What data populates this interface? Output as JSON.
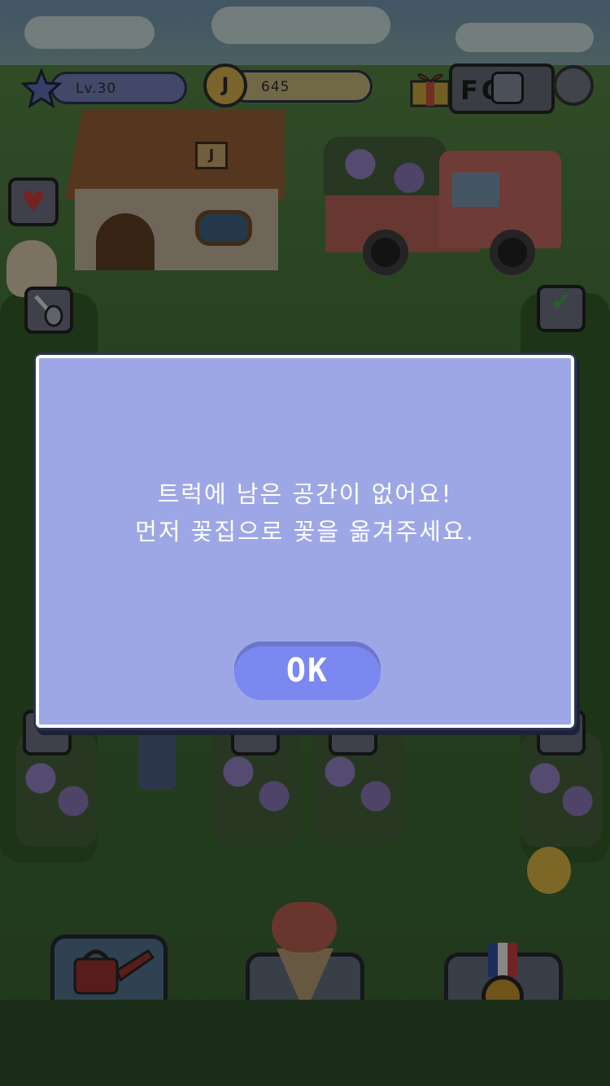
{
  "hud": {
    "level": "Lv.30",
    "coin_symbol": "J",
    "coins": "645",
    "sign_letter": "J",
    "shop_sign": "FOL"
  },
  "dialog": {
    "message_line1": "트럭에 남은 공간이 없어요!",
    "message_line2": "먼저 꽃집으로 꽃을 옮겨주세요.",
    "ok_label": "OK"
  },
  "icons": {
    "level": "star-icon",
    "currency": "coin-icon",
    "gift": "gift-box-icon",
    "camera": "camera-icon",
    "settings": "gear-icon",
    "heart": "heart-icon",
    "shovel": "shovel-icon",
    "check": "checkmark-icon",
    "watering_can": "watering-can-icon",
    "bouquet": "bouquet-icon",
    "medal": "medal-icon"
  },
  "colors": {
    "dialog_bg": "#9ea7e6",
    "ok_button": "#7b88ef",
    "text": "#ffffff"
  }
}
